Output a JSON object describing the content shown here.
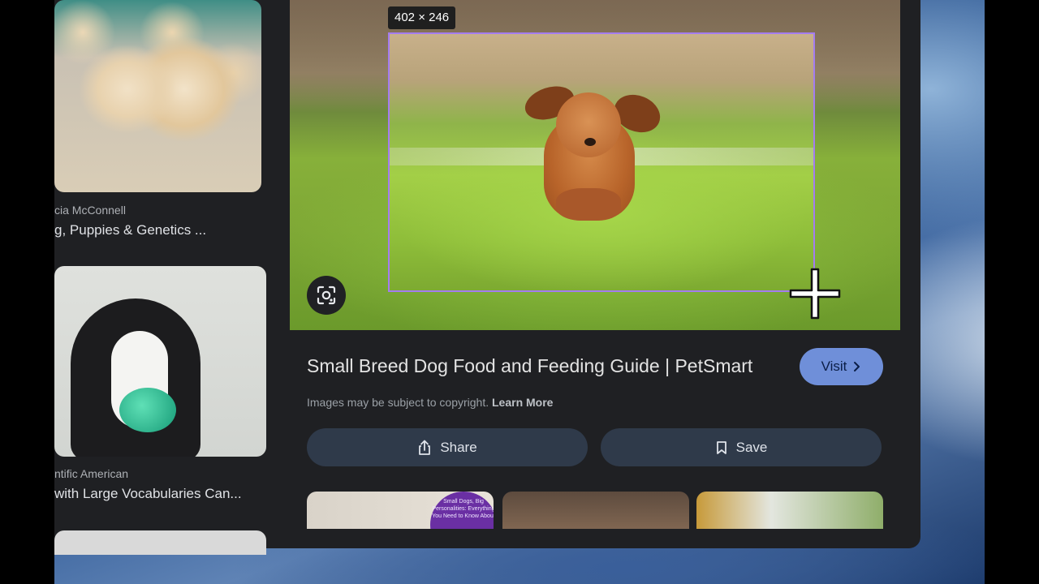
{
  "left_results": [
    {
      "source": "cia McConnell",
      "title": "g, Puppies & Genetics ..."
    },
    {
      "source": "ntific American",
      "title": "with Large Vocabularies Can..."
    }
  ],
  "preview": {
    "size_badge": "402 × 246"
  },
  "result": {
    "title": "Small Breed Dog Food and Feeding Guide | PetSmart",
    "visit_label": "Visit",
    "copyright_text": "Images may be subject to copyright.",
    "learn_more": "Learn More",
    "share_label": "Share",
    "save_label": "Save"
  },
  "related": {
    "thumb1_text": "Small Dogs, Big Personalities: Everything You Need to Know About"
  },
  "colors": {
    "selection_border": "#a47cf0",
    "visit_button": "#6f8fd9",
    "pill_button": "#2f3a4a",
    "panel_bg": "#1f2023"
  },
  "icons": [
    "google-lens-icon",
    "crosshair-cursor-icon",
    "share-icon",
    "bookmark-icon",
    "chevron-right-icon"
  ]
}
